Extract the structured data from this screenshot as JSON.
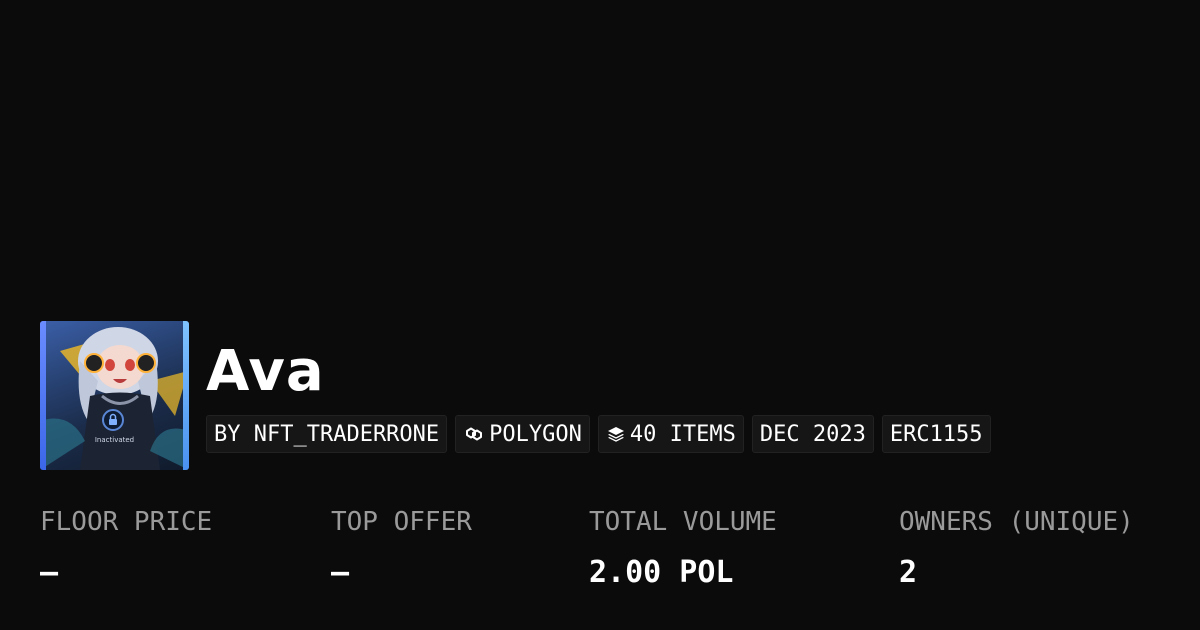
{
  "collection": {
    "title": "Ava",
    "thumbnail": {
      "caption": "Inactivated",
      "badge_icon": "lock-icon"
    }
  },
  "tags": {
    "creator": "BY NFT_TRADERRONE",
    "chain": "POLYGON",
    "chain_icon": "polygon-icon",
    "items": "40 ITEMS",
    "items_icon": "layers-icon",
    "date": "DEC 2023",
    "standard": "ERC1155"
  },
  "stats": {
    "floor_price": {
      "label": "FLOOR PRICE",
      "value": "–"
    },
    "top_offer": {
      "label": "TOP OFFER",
      "value": "–"
    },
    "total_volume": {
      "label": "TOTAL VOLUME",
      "value": "2.00 POL"
    },
    "owners": {
      "label": "OWNERS (UNIQUE)",
      "value": "2"
    }
  },
  "colors": {
    "background": "#0b0b0b",
    "tag_background": "#161616",
    "label": "#9a9a9a",
    "text": "#ffffff"
  }
}
